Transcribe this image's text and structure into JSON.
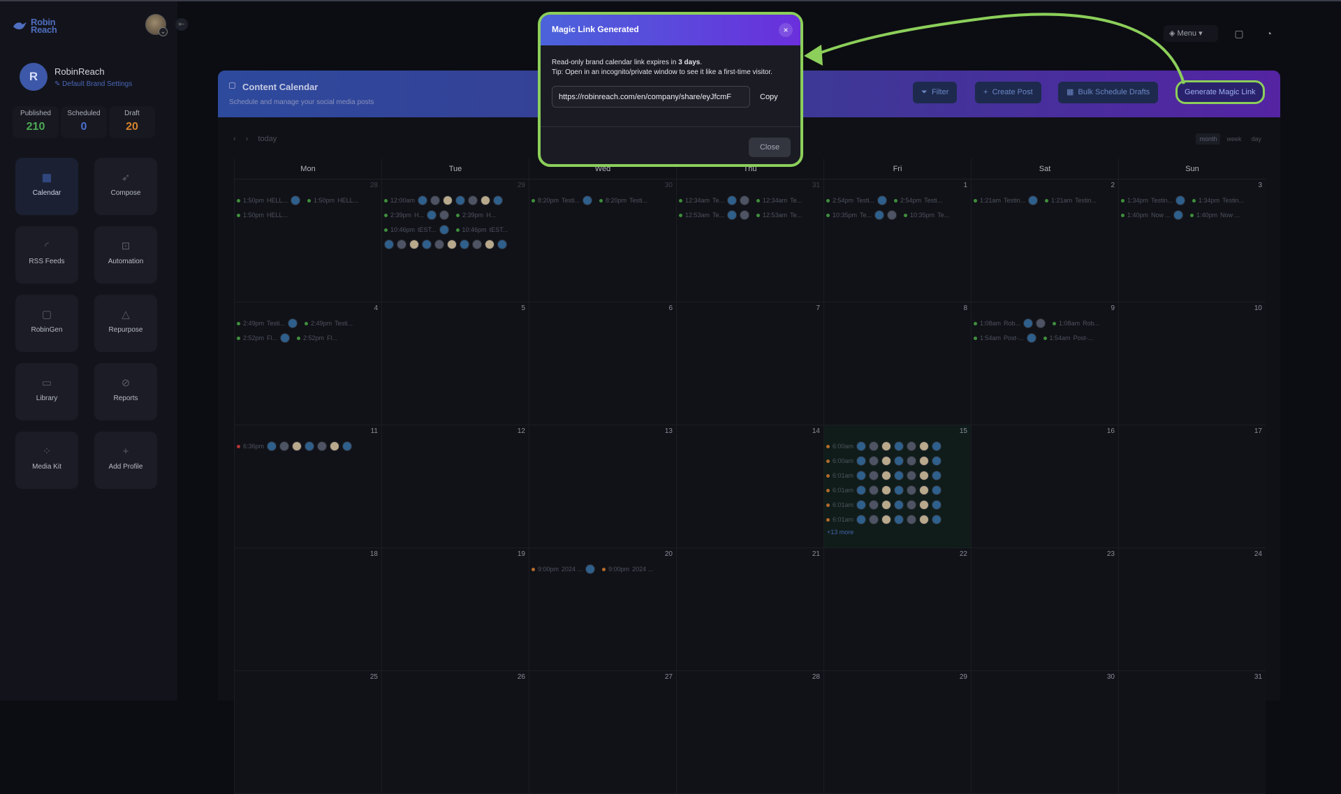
{
  "app": {
    "logo": "Robin Reach"
  },
  "sidebar": {
    "profile": {
      "initial": "R",
      "name": "RobinReach",
      "brand_settings": "Default Brand Settings"
    },
    "stats": [
      {
        "label": "Published",
        "value": "210",
        "color": "#4caa55"
      },
      {
        "label": "Scheduled",
        "value": "0",
        "color": "#4a70d0"
      },
      {
        "label": "Draft",
        "value": "20",
        "color": "#d4822c"
      }
    ],
    "nav": [
      {
        "label": "Calendar",
        "icon": "calendar-icon",
        "glyph": "▦",
        "active": true
      },
      {
        "label": "Compose",
        "icon": "rocket-icon",
        "glyph": "➶"
      },
      {
        "label": "RSS Feeds",
        "icon": "rss-icon",
        "glyph": "◜"
      },
      {
        "label": "Automation",
        "icon": "robot-icon",
        "glyph": "⊡"
      },
      {
        "label": "RobinGen",
        "icon": "document-icon",
        "glyph": "▢"
      },
      {
        "label": "Repurpose",
        "icon": "recycle-icon",
        "glyph": "△"
      },
      {
        "label": "Library",
        "icon": "folder-icon",
        "glyph": "▭"
      },
      {
        "label": "Reports",
        "icon": "chart-icon",
        "glyph": "⊘"
      },
      {
        "label": "Media Kit",
        "icon": "grid-icon",
        "glyph": "⁘"
      },
      {
        "label": "Add Profile",
        "icon": "plus-icon",
        "glyph": "+"
      }
    ]
  },
  "topbar": {
    "menu_label": "Menu"
  },
  "calendar": {
    "title": "Content Calendar",
    "subtitle": "Schedule and manage your social media posts",
    "buttons": {
      "filter": "Filter",
      "create": "Create Post",
      "bulk": "Bulk Schedule Drafts",
      "magic": "Generate Magic Link"
    },
    "nav": {
      "prev": "‹",
      "next": "›",
      "today": "today"
    },
    "views": [
      "month",
      "week",
      "day"
    ],
    "weekdays": [
      "Mon",
      "Tue",
      "Wed",
      "Thu",
      "Fri",
      "Sat",
      "Sun"
    ],
    "weeks": [
      [
        {
          "n": "28",
          "dim": true,
          "events": [
            {
              "t": "1:50pm",
              "x": "HELL...",
              "a": 1,
              "c": "g"
            },
            {
              "t": "1:50pm",
              "x": "HELL...",
              "c": "g"
            }
          ]
        },
        {
          "n": "29",
          "dim": true,
          "events": [
            {
              "t": "12:00am",
              "x": "",
              "a": 7,
              "c": "g"
            },
            {
              "t": "2:39pm",
              "x": "H...",
              "a": 2,
              "c": "g"
            },
            {
              "t": "10:46pm",
              "x": "tEST...",
              "a": 1,
              "c": "g"
            },
            {
              "t": "",
              "x": "",
              "a": 10,
              "c": "n"
            }
          ]
        },
        {
          "n": "30",
          "dim": true,
          "events": [
            {
              "t": "8:20pm",
              "x": "Testi...",
              "a": 1,
              "c": "g"
            }
          ]
        },
        {
          "n": "31",
          "dim": true,
          "events": [
            {
              "t": "12:34am",
              "x": "Te...",
              "a": 2,
              "c": "g"
            },
            {
              "t": "12:53am",
              "x": "Te...",
              "a": 2,
              "c": "g"
            }
          ]
        },
        {
          "n": "1",
          "events": [
            {
              "t": "2:54pm",
              "x": "Testi...",
              "a": 1,
              "c": "g"
            },
            {
              "t": "10:35pm",
              "x": "Te...",
              "a": 2,
              "c": "g"
            }
          ]
        },
        {
          "n": "2",
          "events": [
            {
              "t": "1:21am",
              "x": "Testin...",
              "a": 1,
              "c": "g"
            }
          ]
        },
        {
          "n": "3",
          "events": [
            {
              "t": "1:34pm",
              "x": "Testin...",
              "a": 1,
              "c": "g"
            },
            {
              "t": "1:40pm",
              "x": "Now ...",
              "a": 1,
              "c": "g"
            }
          ]
        }
      ],
      [
        {
          "n": "4",
          "events": [
            {
              "t": "2:49pm",
              "x": "Testi...",
              "a": 1,
              "c": "g"
            },
            {
              "t": "2:52pm",
              "x": "Fl...",
              "a": 1,
              "c": "g"
            }
          ]
        },
        {
          "n": "5",
          "events": []
        },
        {
          "n": "6",
          "events": []
        },
        {
          "n": "7",
          "events": []
        },
        {
          "n": "8",
          "events": []
        },
        {
          "n": "9",
          "events": [
            {
              "t": "1:08am",
              "x": "Rob...",
              "a": 2,
              "c": "g"
            },
            {
              "t": "1:54am",
              "x": "Post-...",
              "a": 1,
              "c": "g"
            }
          ]
        },
        {
          "n": "10",
          "events": []
        }
      ],
      [
        {
          "n": "11",
          "events": [
            {
              "t": "6:36pm",
              "x": "",
              "a": 7,
              "c": "r"
            }
          ]
        },
        {
          "n": "12",
          "events": []
        },
        {
          "n": "13",
          "events": []
        },
        {
          "n": "14",
          "events": []
        },
        {
          "n": "15",
          "today": true,
          "more": "+13 more",
          "events": [
            {
              "t": "6:00am",
              "x": "",
              "a": 7,
              "c": "o"
            },
            {
              "t": "6:00am",
              "x": "",
              "a": 7,
              "c": "o"
            },
            {
              "t": "6:01am",
              "x": "",
              "a": 7,
              "c": "o"
            },
            {
              "t": "6:01am",
              "x": "",
              "a": 7,
              "c": "o"
            },
            {
              "t": "6:01am",
              "x": "",
              "a": 7,
              "c": "o"
            },
            {
              "t": "6:01am",
              "x": "",
              "a": 7,
              "c": "o"
            }
          ]
        },
        {
          "n": "16",
          "events": []
        },
        {
          "n": "17",
          "events": []
        }
      ],
      [
        {
          "n": "18",
          "events": []
        },
        {
          "n": "19",
          "events": []
        },
        {
          "n": "20",
          "events": [
            {
              "t": "9:00pm",
              "x": "2024 ...",
              "a": 1,
              "c": "o"
            }
          ]
        },
        {
          "n": "21",
          "events": []
        },
        {
          "n": "22",
          "events": []
        },
        {
          "n": "23",
          "events": []
        },
        {
          "n": "24",
          "events": []
        }
      ],
      [
        {
          "n": "25",
          "events": []
        },
        {
          "n": "26",
          "events": []
        },
        {
          "n": "27",
          "events": []
        },
        {
          "n": "28",
          "events": []
        },
        {
          "n": "29",
          "events": []
        },
        {
          "n": "30",
          "events": []
        },
        {
          "n": "31",
          "events": []
        }
      ]
    ]
  },
  "modal": {
    "title": "Magic Link Generated",
    "close_x": "×",
    "line1_pre": "Read-only brand calendar link expires in ",
    "line1_bold": "3 days",
    "line1_post": ".",
    "line2": "Tip: Open in an incognito/private window to see it like a first-time visitor.",
    "link_value": "https://robinreach.com/en/company/share/eyJfcmF",
    "copy": "Copy",
    "close": "Close"
  },
  "colors": {
    "highlight": "#8ccf5a",
    "accent": "#4b63db"
  }
}
